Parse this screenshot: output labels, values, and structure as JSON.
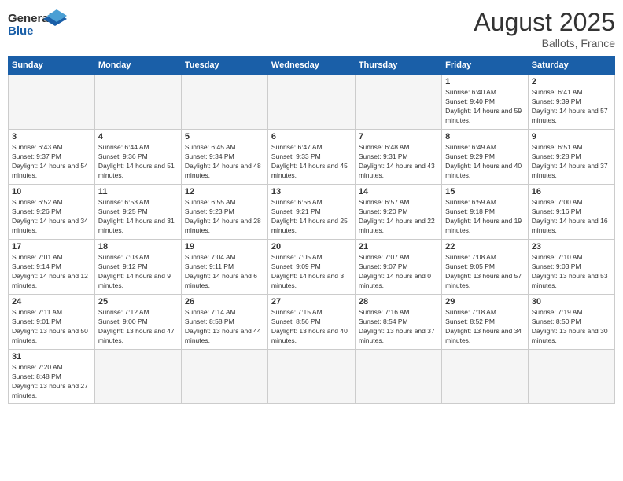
{
  "logo": {
    "general": "General",
    "blue": "Blue"
  },
  "title": "August 2025",
  "subtitle": "Ballots, France",
  "days_header": [
    "Sunday",
    "Monday",
    "Tuesday",
    "Wednesday",
    "Thursday",
    "Friday",
    "Saturday"
  ],
  "weeks": [
    [
      {
        "day": "",
        "info": ""
      },
      {
        "day": "",
        "info": ""
      },
      {
        "day": "",
        "info": ""
      },
      {
        "day": "",
        "info": ""
      },
      {
        "day": "",
        "info": ""
      },
      {
        "day": "1",
        "info": "Sunrise: 6:40 AM\nSunset: 9:40 PM\nDaylight: 14 hours and 59 minutes."
      },
      {
        "day": "2",
        "info": "Sunrise: 6:41 AM\nSunset: 9:39 PM\nDaylight: 14 hours and 57 minutes."
      }
    ],
    [
      {
        "day": "3",
        "info": "Sunrise: 6:43 AM\nSunset: 9:37 PM\nDaylight: 14 hours and 54 minutes."
      },
      {
        "day": "4",
        "info": "Sunrise: 6:44 AM\nSunset: 9:36 PM\nDaylight: 14 hours and 51 minutes."
      },
      {
        "day": "5",
        "info": "Sunrise: 6:45 AM\nSunset: 9:34 PM\nDaylight: 14 hours and 48 minutes."
      },
      {
        "day": "6",
        "info": "Sunrise: 6:47 AM\nSunset: 9:33 PM\nDaylight: 14 hours and 45 minutes."
      },
      {
        "day": "7",
        "info": "Sunrise: 6:48 AM\nSunset: 9:31 PM\nDaylight: 14 hours and 43 minutes."
      },
      {
        "day": "8",
        "info": "Sunrise: 6:49 AM\nSunset: 9:29 PM\nDaylight: 14 hours and 40 minutes."
      },
      {
        "day": "9",
        "info": "Sunrise: 6:51 AM\nSunset: 9:28 PM\nDaylight: 14 hours and 37 minutes."
      }
    ],
    [
      {
        "day": "10",
        "info": "Sunrise: 6:52 AM\nSunset: 9:26 PM\nDaylight: 14 hours and 34 minutes."
      },
      {
        "day": "11",
        "info": "Sunrise: 6:53 AM\nSunset: 9:25 PM\nDaylight: 14 hours and 31 minutes."
      },
      {
        "day": "12",
        "info": "Sunrise: 6:55 AM\nSunset: 9:23 PM\nDaylight: 14 hours and 28 minutes."
      },
      {
        "day": "13",
        "info": "Sunrise: 6:56 AM\nSunset: 9:21 PM\nDaylight: 14 hours and 25 minutes."
      },
      {
        "day": "14",
        "info": "Sunrise: 6:57 AM\nSunset: 9:20 PM\nDaylight: 14 hours and 22 minutes."
      },
      {
        "day": "15",
        "info": "Sunrise: 6:59 AM\nSunset: 9:18 PM\nDaylight: 14 hours and 19 minutes."
      },
      {
        "day": "16",
        "info": "Sunrise: 7:00 AM\nSunset: 9:16 PM\nDaylight: 14 hours and 16 minutes."
      }
    ],
    [
      {
        "day": "17",
        "info": "Sunrise: 7:01 AM\nSunset: 9:14 PM\nDaylight: 14 hours and 12 minutes."
      },
      {
        "day": "18",
        "info": "Sunrise: 7:03 AM\nSunset: 9:12 PM\nDaylight: 14 hours and 9 minutes."
      },
      {
        "day": "19",
        "info": "Sunrise: 7:04 AM\nSunset: 9:11 PM\nDaylight: 14 hours and 6 minutes."
      },
      {
        "day": "20",
        "info": "Sunrise: 7:05 AM\nSunset: 9:09 PM\nDaylight: 14 hours and 3 minutes."
      },
      {
        "day": "21",
        "info": "Sunrise: 7:07 AM\nSunset: 9:07 PM\nDaylight: 14 hours and 0 minutes."
      },
      {
        "day": "22",
        "info": "Sunrise: 7:08 AM\nSunset: 9:05 PM\nDaylight: 13 hours and 57 minutes."
      },
      {
        "day": "23",
        "info": "Sunrise: 7:10 AM\nSunset: 9:03 PM\nDaylight: 13 hours and 53 minutes."
      }
    ],
    [
      {
        "day": "24",
        "info": "Sunrise: 7:11 AM\nSunset: 9:01 PM\nDaylight: 13 hours and 50 minutes."
      },
      {
        "day": "25",
        "info": "Sunrise: 7:12 AM\nSunset: 9:00 PM\nDaylight: 13 hours and 47 minutes."
      },
      {
        "day": "26",
        "info": "Sunrise: 7:14 AM\nSunset: 8:58 PM\nDaylight: 13 hours and 44 minutes."
      },
      {
        "day": "27",
        "info": "Sunrise: 7:15 AM\nSunset: 8:56 PM\nDaylight: 13 hours and 40 minutes."
      },
      {
        "day": "28",
        "info": "Sunrise: 7:16 AM\nSunset: 8:54 PM\nDaylight: 13 hours and 37 minutes."
      },
      {
        "day": "29",
        "info": "Sunrise: 7:18 AM\nSunset: 8:52 PM\nDaylight: 13 hours and 34 minutes."
      },
      {
        "day": "30",
        "info": "Sunrise: 7:19 AM\nSunset: 8:50 PM\nDaylight: 13 hours and 30 minutes."
      }
    ],
    [
      {
        "day": "31",
        "info": "Sunrise: 7:20 AM\nSunset: 8:48 PM\nDaylight: 13 hours and 27 minutes."
      },
      {
        "day": "",
        "info": ""
      },
      {
        "day": "",
        "info": ""
      },
      {
        "day": "",
        "info": ""
      },
      {
        "day": "",
        "info": ""
      },
      {
        "day": "",
        "info": ""
      },
      {
        "day": "",
        "info": ""
      }
    ]
  ]
}
